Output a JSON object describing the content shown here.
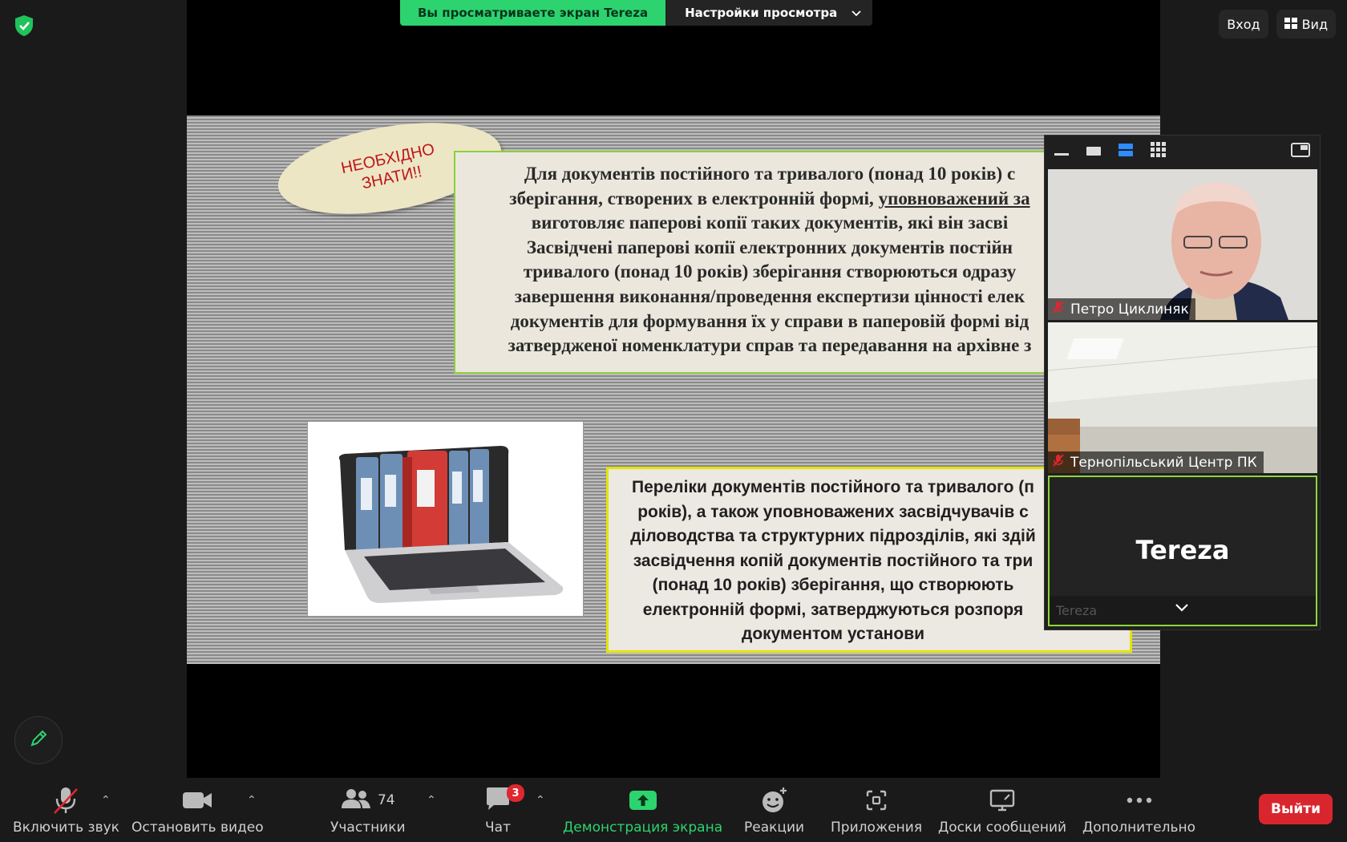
{
  "banner": {
    "viewing_text": "Вы просматриваете экран Tereza",
    "settings_text": "Настройки просмотра"
  },
  "top_right": {
    "login_label": "Вход",
    "view_label": "Вид"
  },
  "slide": {
    "badge_text_line1": "НЕОБХІДНО",
    "badge_text_line2": "ЗНАТИ!!",
    "box1_lines": [
      "Для документів постійного та тривалого (понад 10 років) с",
      "зберігання, створених в електронній формі, ",
      "виготовляє паперові копії таких документів, які він засві",
      "Засвідчені паперові копії електронних документів постійн",
      "тривалого (понад 10 років) зберігання створюються  одразу",
      "завершення виконання/проведення експертизи цінності елек",
      "документів для формування їх у справи в паперовій формі від",
      "затвердженої номенклатури справ та передавання на архівне з"
    ],
    "box1_underlined": "уповноважений за",
    "box2_lines": [
      "Переліки документів постійного та тривалого (п",
      "років), а також уповноважених засвідчувачів с",
      "діловодства та структурних підрозділів, які здій",
      "засвідчення копій документів постійного та три",
      "(понад 10 років) зберігання, що створюють",
      "електронній формі, затверджуються розпоря",
      "документом установи"
    ]
  },
  "gallery": {
    "participants": [
      {
        "name": "Петро Циклиняк"
      },
      {
        "name": "Тернопільський Центр ПК"
      },
      {
        "name": "Tereza",
        "footer_name": "Tereza"
      }
    ]
  },
  "toolbar": {
    "audio_label": "Включить звук",
    "video_label": "Остановить видео",
    "participants_label": "Участники",
    "participants_count": "74",
    "chat_label": "Чат",
    "chat_badge": "3",
    "share_label": "Демонстрация экрана",
    "reactions_label": "Реакции",
    "apps_label": "Приложения",
    "whiteboards_label": "Доски сообщений",
    "more_label": "Дополнительно",
    "exit_label": "Выйти"
  },
  "colors": {
    "accent_green": "#2dd36f",
    "exit_red": "#d9262e",
    "active_border": "#8dd63a"
  }
}
